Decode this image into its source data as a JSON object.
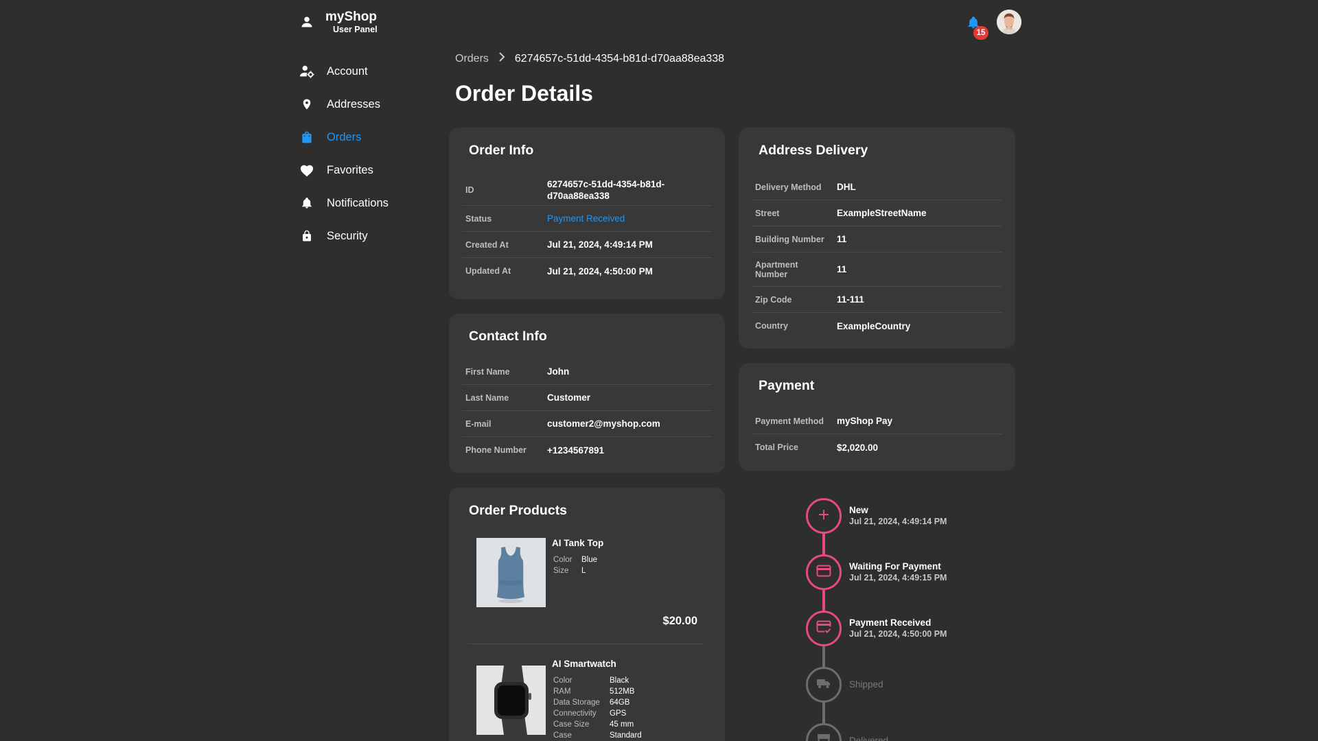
{
  "brand": {
    "name": "myShop",
    "subtitle": "User Panel"
  },
  "header": {
    "notification_count": "15"
  },
  "sidebar": {
    "items": [
      {
        "label": "Account",
        "icon": "manage-accounts-icon"
      },
      {
        "label": "Addresses",
        "icon": "location-pin-icon"
      },
      {
        "label": "Orders",
        "icon": "shopping-bag-icon",
        "active": true
      },
      {
        "label": "Favorites",
        "icon": "heart-icon"
      },
      {
        "label": "Notifications",
        "icon": "bell-icon"
      },
      {
        "label": "Security",
        "icon": "lock-icon"
      }
    ]
  },
  "breadcrumb": {
    "parent": "Orders",
    "current": "6274657c-51dd-4354-b81d-d70aa88ea338"
  },
  "page": {
    "title": "Order Details"
  },
  "order_info": {
    "title": "Order Info",
    "rows": [
      {
        "key": "ID",
        "value": "6274657c-51dd-4354-b81d-d70aa88ea338"
      },
      {
        "key": "Status",
        "value": "Payment Received"
      },
      {
        "key": "Created At",
        "value": "Jul 21, 2024, 4:49:14 PM"
      },
      {
        "key": "Updated At",
        "value": "Jul 21, 2024, 4:50:00 PM"
      }
    ]
  },
  "contact_info": {
    "title": "Contact Info",
    "rows": [
      {
        "key": "First Name",
        "value": "John"
      },
      {
        "key": "Last Name",
        "value": "Customer"
      },
      {
        "key": "E-mail",
        "value": "customer2@myshop.com"
      },
      {
        "key": "Phone Number",
        "value": "+1234567891"
      }
    ]
  },
  "address_delivery": {
    "title": "Address Delivery",
    "rows": [
      {
        "key": "Delivery Method",
        "value": "DHL"
      },
      {
        "key": "Street",
        "value": "ExampleStreetName"
      },
      {
        "key": "Building Number",
        "value": "11"
      },
      {
        "key": "Apartment Number",
        "value": "11"
      },
      {
        "key": "Zip Code",
        "value": "11-111"
      },
      {
        "key": "Country",
        "value": "ExampleCountry"
      }
    ]
  },
  "payment": {
    "title": "Payment",
    "rows": [
      {
        "key": "Payment Method",
        "value": "myShop Pay"
      },
      {
        "key": "Total Price",
        "value": "$2,020.00"
      }
    ]
  },
  "order_products": {
    "title": "Order Products",
    "items": [
      {
        "name": "AI Tank Top",
        "attrs": [
          {
            "k": "Color",
            "v": "Blue"
          },
          {
            "k": "Size",
            "v": "L"
          }
        ],
        "price": "$20.00"
      },
      {
        "name": "AI Smartwatch",
        "attrs": [
          {
            "k": "Color",
            "v": "Black"
          },
          {
            "k": "RAM",
            "v": "512MB"
          },
          {
            "k": "Data Storage",
            "v": "64GB"
          },
          {
            "k": "Connectivity",
            "v": "GPS"
          },
          {
            "k": "Case Size",
            "v": "45 mm"
          },
          {
            "k": "Case",
            "v": "Standard"
          }
        ]
      }
    ]
  },
  "timeline": {
    "accent": "#e84a7f",
    "steps": [
      {
        "label": "New",
        "date": "Jul 21, 2024, 4:49:14 PM",
        "icon": "plus-icon",
        "done": true
      },
      {
        "label": "Waiting For Payment",
        "date": "Jul 21, 2024, 4:49:15 PM",
        "icon": "credit-card-icon",
        "done": true
      },
      {
        "label": "Payment Received",
        "date": "Jul 21, 2024, 4:50:00 PM",
        "icon": "card-check-icon",
        "done": true
      },
      {
        "label": "Shipped",
        "date": "",
        "icon": "truck-icon",
        "done": false
      },
      {
        "label": "Delivered",
        "date": "",
        "icon": "box-icon",
        "done": false
      }
    ]
  }
}
